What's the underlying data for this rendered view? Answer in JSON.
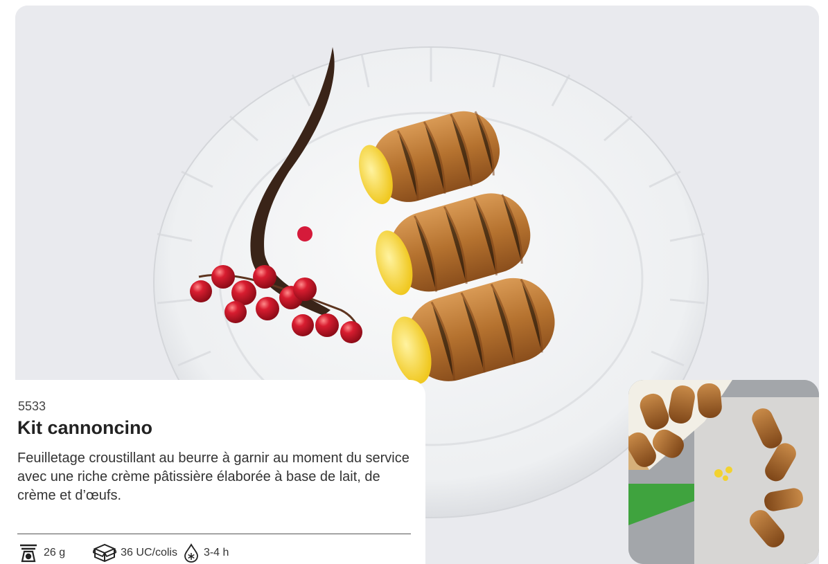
{
  "product": {
    "code": "5533",
    "title": "Kit cannoncino",
    "description": "Feuilletage croustillant au beurre à garnir au moment du service avec une riche crème pâtissière élaborée à base de lait, de crème et d’œufs."
  },
  "specs": {
    "weight": {
      "icon": "scale-icon",
      "value": "26 g"
    },
    "pack": {
      "icon": "box-icon",
      "value": "36 UC/colis"
    },
    "thaw": {
      "icon": "thaw-drop-icon",
      "value": "3-4 h"
    }
  },
  "colors": {
    "text": "#333333",
    "pastry": "#b9783a",
    "cream": "#f5d233",
    "currant": "#c4162a"
  }
}
